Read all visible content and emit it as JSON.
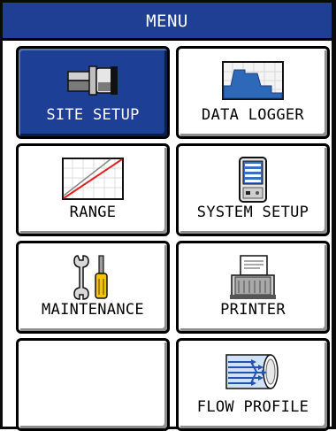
{
  "header": {
    "title": "MENU"
  },
  "tiles": [
    {
      "label": "SITE SETUP",
      "icon": "pipe-sensor-icon",
      "selected": true
    },
    {
      "label": "DATA LOGGER",
      "icon": "data-graph-icon"
    },
    {
      "label": "RANGE",
      "icon": "range-line-icon"
    },
    {
      "label": "SYSTEM SETUP",
      "icon": "meter-device-icon"
    },
    {
      "label": "MAINTENANCE",
      "icon": "wrench-screwdriver-icon"
    },
    {
      "label": "PRINTER",
      "icon": "printer-icon"
    },
    {
      "label": "",
      "icon": ""
    },
    {
      "label": "FLOW PROFILE",
      "icon": "flow-pipe-icon"
    }
  ],
  "colors": {
    "header_bg": "#1f3f95",
    "selected_bg": "#1d3f95",
    "tile_bg": "#ffffff"
  }
}
